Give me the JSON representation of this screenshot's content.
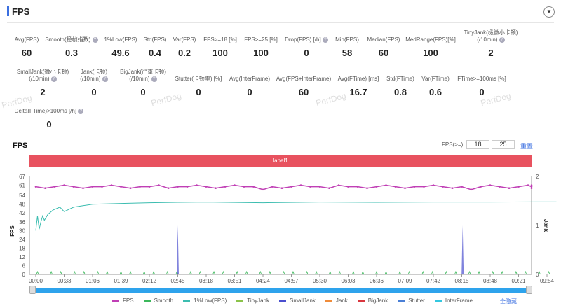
{
  "header": {
    "title": "FPS",
    "dropdown_icon": "caret-down-icon"
  },
  "metrics": [
    {
      "label": "Avg(FPS)",
      "value": "60"
    },
    {
      "label": "Smooth(稳帧指数)",
      "value": "0.3",
      "help": true
    },
    {
      "label": "1%Low(FPS)",
      "value": "49.6"
    },
    {
      "label": "Std(FPS)",
      "value": "0.4"
    },
    {
      "label": "Var(FPS)",
      "value": "0.2"
    },
    {
      "label": "FPS>=18 [%]",
      "value": "100"
    },
    {
      "label": "FPS>=25 [%]",
      "value": "100"
    },
    {
      "label": "Drop(FPS) [/h]",
      "value": "0",
      "help": true
    },
    {
      "label": "Min(FPS)",
      "value": "58"
    },
    {
      "label": "Median(FPS)",
      "value": "60"
    },
    {
      "label": "MedRange(FPS)[%]",
      "value": "100"
    },
    {
      "label": "TinyJank(极微小卡顿)",
      "label2": "(/10min)",
      "value": "2",
      "help": true
    },
    {
      "label": "SmallJank(微小卡顿)",
      "label2": "(/10min)",
      "value": "2",
      "help": true
    },
    {
      "label": "Jank(卡顿)",
      "label2": "(/10min)",
      "value": "0",
      "help": true
    },
    {
      "label": "BigJank(严重卡顿)",
      "label2": "(/10min)",
      "value": "0",
      "help": true
    },
    {
      "label": "Stutter(卡顿率) [%]",
      "value": "0"
    },
    {
      "label": "Avg(InterFrame)",
      "value": "0"
    },
    {
      "label": "Avg(FPS+InterFrame)",
      "value": "60"
    },
    {
      "label": "Avg(FTime) [ms]",
      "value": "16.7"
    },
    {
      "label": "Std(FTime)",
      "value": "0.8"
    },
    {
      "label": "Var(FTime)",
      "value": "0.6"
    },
    {
      "label": "FTime>=100ms [%]",
      "value": "0"
    },
    {
      "label": "Delta(FTime)>100ms [/h]",
      "value": "0",
      "help": true
    }
  ],
  "chart_section": {
    "title": "FPS",
    "fps_threshold_label": "FPS(>=)",
    "threshold1": "18",
    "threshold2": "25",
    "reset_label": "重置",
    "label_bar": "label1",
    "hide_all_label": "全隐藏",
    "watermark": "PerfDog"
  },
  "chart_data": {
    "type": "line",
    "ylabel": "FPS",
    "y2label": "Jank",
    "ylim": [
      0,
      67
    ],
    "yticks": [
      0,
      6,
      12,
      18,
      24,
      30,
      36,
      42,
      48,
      54,
      61,
      67
    ],
    "y2lim": [
      0,
      2
    ],
    "y2ticks": [
      0,
      1,
      2
    ],
    "xlim": [
      0,
      605
    ],
    "xticks": [
      "00:00",
      "00:33",
      "01:06",
      "01:39",
      "02:12",
      "02:45",
      "03:18",
      "03:51",
      "04:24",
      "04:57",
      "05:30",
      "06:03",
      "06:36",
      "07:09",
      "07:42",
      "08:15",
      "08:48",
      "09:21",
      "09:54"
    ],
    "legend_position": "bottom",
    "series": [
      {
        "name": "FPS",
        "color": "#c03fb5",
        "axis": "left",
        "x": [
          0,
          11,
          22,
          33,
          44,
          55,
          66,
          77,
          88,
          99,
          110,
          121,
          132,
          143,
          154,
          165,
          176,
          187,
          198,
          209,
          220,
          231,
          242,
          253,
          264,
          275,
          286,
          297,
          308,
          319,
          330,
          341,
          352,
          363,
          374,
          385,
          396,
          407,
          418,
          429,
          440,
          451,
          462,
          473,
          484,
          495,
          506,
          517,
          528,
          539,
          550,
          561,
          572,
          583,
          594,
          605
        ],
        "y": [
          60,
          59,
          60,
          61,
          60,
          59,
          60,
          60,
          61,
          60,
          59,
          60,
          60,
          61,
          59,
          60,
          60,
          61,
          60,
          59,
          60,
          61,
          60,
          60,
          58,
          60,
          59,
          60,
          61,
          60,
          60,
          59,
          61,
          60,
          60,
          59,
          60,
          61,
          60,
          59,
          60,
          60,
          61,
          60,
          59,
          60,
          58,
          60,
          61,
          60,
          59,
          60,
          61,
          60,
          59,
          61
        ]
      },
      {
        "name": "Smooth",
        "color": "#3cb85b",
        "axis": "left"
      },
      {
        "name": "1%Low(FPS)",
        "color": "#3cbdb0",
        "axis": "left",
        "x": [
          0,
          2,
          4,
          6,
          8,
          10,
          14,
          20,
          28,
          33,
          44,
          55,
          66,
          99,
          132,
          165,
          198,
          264,
          330,
          396,
          462,
          528,
          605
        ],
        "y": [
          30,
          40,
          31,
          36,
          40,
          37,
          41,
          44,
          46,
          43,
          46,
          47,
          48,
          48.5,
          49,
          49.3,
          49.5,
          49,
          49.5,
          49.3,
          49.5,
          49.5,
          49.6
        ]
      },
      {
        "name": "TinyJank",
        "color": "#8bc34a",
        "axis": "right"
      },
      {
        "name": "SmallJank",
        "color": "#4a4fcf",
        "axis": "right",
        "spikes": [
          {
            "x": 165,
            "y": 1
          },
          {
            "x": 496,
            "y": 1
          }
        ]
      },
      {
        "name": "Jank",
        "color": "#f08c3a",
        "axis": "right"
      },
      {
        "name": "BigJank",
        "color": "#d9363e",
        "axis": "right"
      },
      {
        "name": "Stutter",
        "color": "#4a7fd6",
        "axis": "right"
      },
      {
        "name": "InterFrame",
        "color": "#34c8e0",
        "axis": "right"
      }
    ]
  }
}
